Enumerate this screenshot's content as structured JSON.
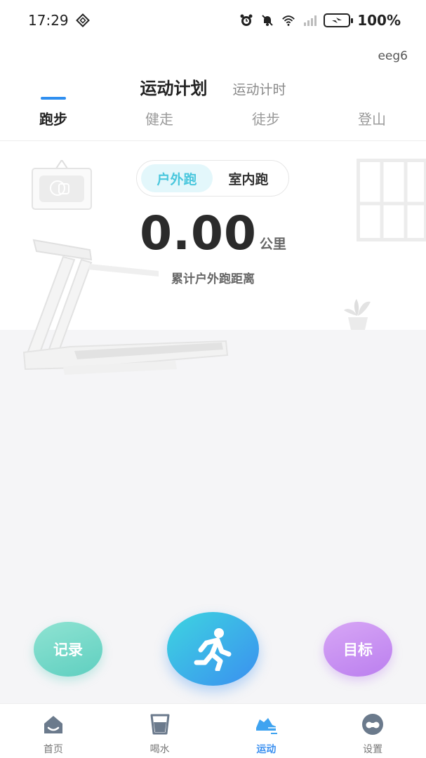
{
  "status_bar": {
    "time": "17:29",
    "battery": "100%",
    "icons": [
      "alarm-icon",
      "mute-icon",
      "wifi-icon",
      "signal-icon",
      "battery-charging-icon"
    ]
  },
  "header": {
    "user_id": "eeg6",
    "top_tabs": [
      {
        "label": "运动计划",
        "active": true
      },
      {
        "label": "运动计时",
        "active": false
      }
    ],
    "sport_tabs": [
      {
        "label": "跑步",
        "active": true
      },
      {
        "label": "健走",
        "active": false
      },
      {
        "label": "徒步",
        "active": false
      },
      {
        "label": "登山",
        "active": false
      }
    ]
  },
  "run_mode": {
    "options": [
      {
        "label": "户外跑",
        "active": true
      },
      {
        "label": "室内跑",
        "active": false
      }
    ]
  },
  "distance": {
    "value": "0.00",
    "unit": "公里",
    "label": "累计户外跑距离"
  },
  "actions": {
    "records_label": "记录",
    "start_icon": "running-person-icon",
    "goal_label": "目标"
  },
  "bottom_nav": {
    "items": [
      {
        "label": "首页",
        "icon": "home-icon",
        "active": false
      },
      {
        "label": "喝水",
        "icon": "water-cup-icon",
        "active": false
      },
      {
        "label": "运动",
        "icon": "sneaker-icon",
        "active": true
      },
      {
        "label": "设置",
        "icon": "settings-face-icon",
        "active": false
      }
    ]
  },
  "colors": {
    "accent_blue": "#3a8ff0",
    "accent_cyan": "#4ac7dd",
    "records_green": "#5fcfc0",
    "goal_purple": "#bb7fef"
  }
}
